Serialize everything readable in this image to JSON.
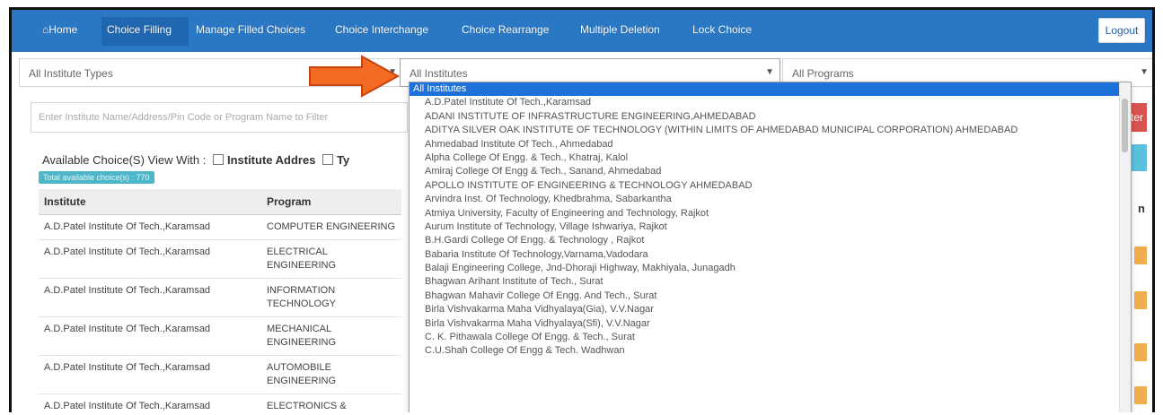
{
  "navbar": {
    "items": [
      {
        "label": "⌂Home"
      },
      {
        "label": "Choice Filling"
      },
      {
        "label": "Manage Filled Choices"
      },
      {
        "label": "Choice Interchange"
      },
      {
        "label": "Choice Rearrange"
      },
      {
        "label": "Multiple Deletion"
      },
      {
        "label": "Lock Choice"
      }
    ],
    "logout_label": "Logout"
  },
  "filters": {
    "institute_type": "All Institute Types",
    "institute": "All Institutes",
    "program": "All Programs"
  },
  "search": {
    "placeholder": "Enter Institute Name/Address/Pin Code or Program Name to Filter"
  },
  "filter_button_label": "ilter",
  "view_with": {
    "label": "Available Choice(S) View With :",
    "option_address": "Institute Addres",
    "option_type": "Ty"
  },
  "badge_text": "Total available choice(s) : 770",
  "table": {
    "headers": [
      "Institute",
      "Program"
    ],
    "edge_header": "n",
    "rows": [
      {
        "institute": "A.D.Patel Institute Of Tech.,Karamsad",
        "program": "COMPUTER ENGINEERING"
      },
      {
        "institute": "A.D.Patel Institute Of Tech.,Karamsad",
        "program": "ELECTRICAL ENGINEERING"
      },
      {
        "institute": "A.D.Patel Institute Of Tech.,Karamsad",
        "program": "INFORMATION TECHNOLOGY"
      },
      {
        "institute": "A.D.Patel Institute Of Tech.,Karamsad",
        "program": "MECHANICAL ENGINEERING"
      },
      {
        "institute": "A.D.Patel Institute Of Tech.,Karamsad",
        "program": "AUTOMOBILE ENGINEERING"
      },
      {
        "institute": "A.D.Patel Institute Of Tech.,Karamsad",
        "program": "ELECTRONICS &"
      }
    ]
  },
  "dropdown": {
    "options": [
      "All Institutes",
      "A.D.Patel Institute Of Tech.,Karamsad",
      "ADANI INSTITUTE OF INFRASTRUCTURE ENGINEERING,AHMEDABAD",
      "ADITYA SILVER OAK INSTITUTE OF TECHNOLOGY (WITHIN LIMITS OF AHMEDABAD MUNICIPAL CORPORATION) AHMEDABAD",
      "Ahmedabad Institute Of Tech., Ahmedabad",
      "Alpha College Of Engg. & Tech., Khatraj, Kalol",
      "Amiraj College Of Engg & Tech., Sanand, Ahmedabad",
      "APOLLO INSTITUTE OF ENGINEERING & TECHNOLOGY AHMEDABAD",
      "Arvindra Inst. Of Technology, Khedbrahma, Sabarkantha",
      "Atmiya University, Faculty of Engineering and Technology, Rajkot",
      "Aurum Institute of Technology, Village Ishwariya, Rajkot",
      "B.H.Gardi College Of Engg. & Technology , Rajkot",
      "Babaria Institute Of Technology,Varnama,Vadodara",
      "Balaji Engineering College, Jnd-Dhoraji Highway, Makhiyala, Junagadh",
      "Bhagwan Arihant Institute of Tech., Surat",
      "Bhagwan Mahavir College Of Engg. And Tech., Surat",
      "Birla Vishvakarma Maha Vidhyalaya(Gia), V.V.Nagar",
      "Birla Vishvakarma Maha Vidhyalaya(Sfi), V.V.Nagar",
      "C. K. Pithawala College Of Engg. & Tech., Surat",
      "C.U.Shah College Of Engg & Tech. Wadhwan"
    ]
  }
}
